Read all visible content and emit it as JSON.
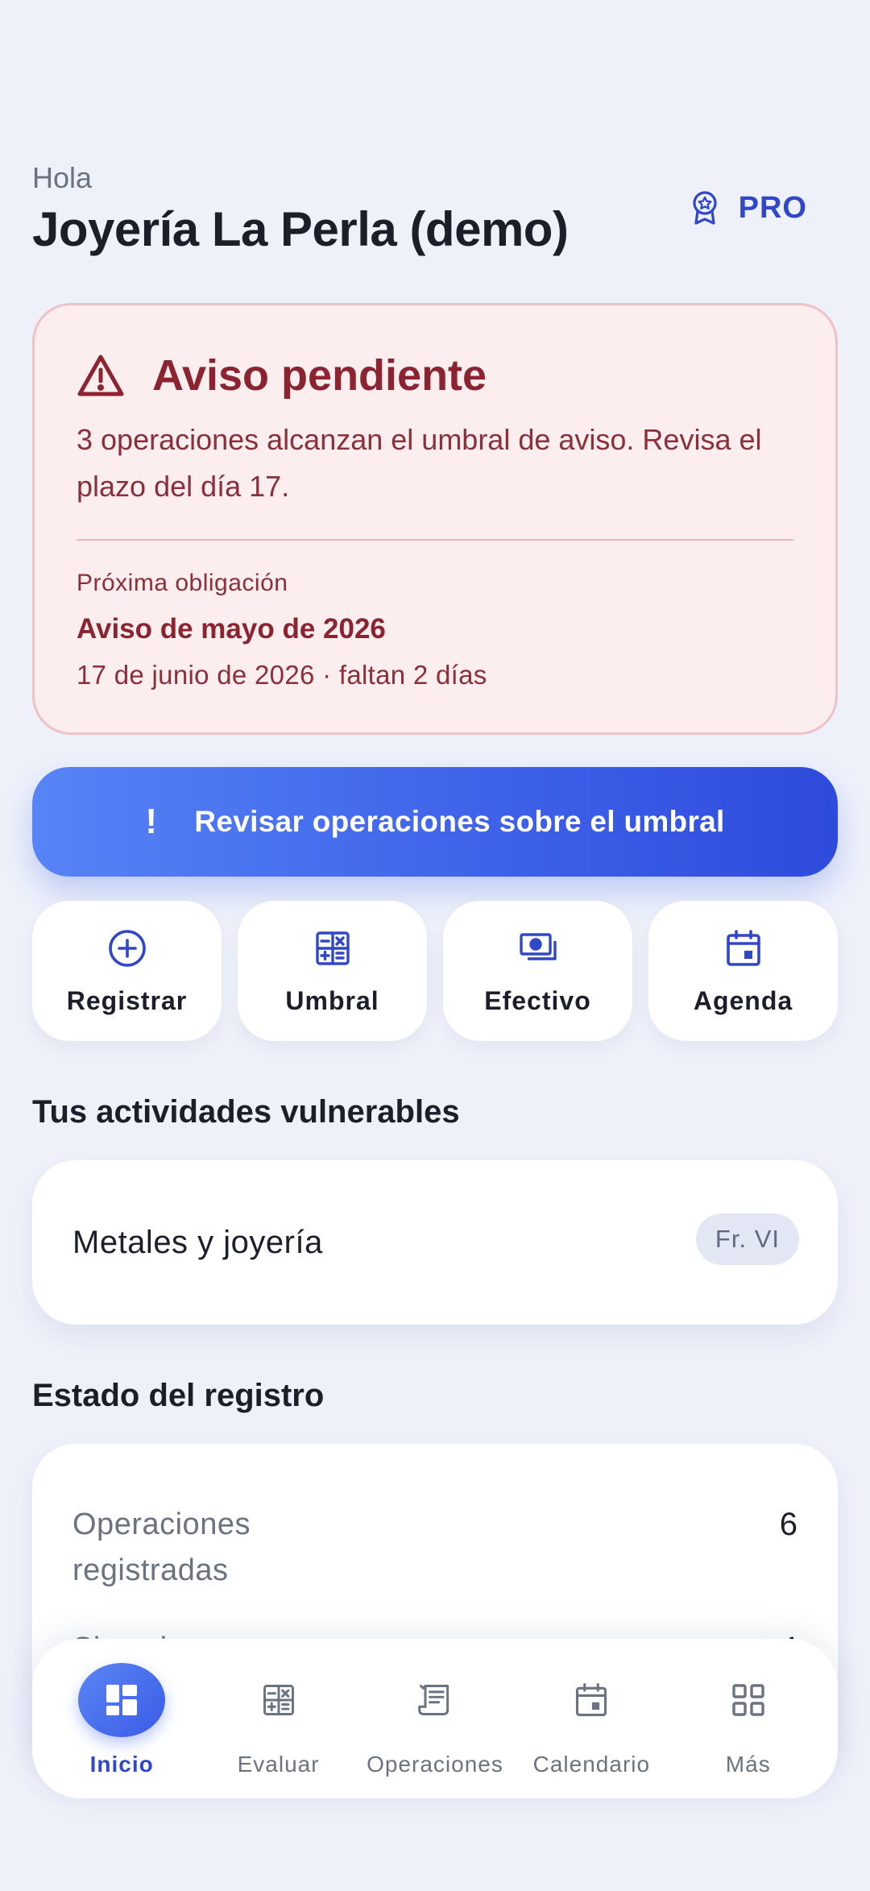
{
  "header": {
    "greeting": "Hola",
    "business_name": "Joyería La Perla (demo)",
    "plan_badge": "PRO",
    "plan_icon": "award-icon"
  },
  "alert": {
    "icon": "warning-triangle-icon",
    "title": "Aviso pendiente",
    "message": "3 operaciones alcanzan el umbral de aviso. Revisa el plazo del día 17.",
    "next_label": "Próxima obligación",
    "next_title": "Aviso de mayo de 2026",
    "next_date": "17 de junio de 2026 · faltan 2 días"
  },
  "cta": {
    "icon_glyph": "!",
    "label": "Revisar operaciones sobre el umbral"
  },
  "quick_actions": [
    {
      "label": "Registrar",
      "icon": "plus-circle-icon"
    },
    {
      "label": "Umbral",
      "icon": "calculator-icon"
    },
    {
      "label": "Efectivo",
      "icon": "cash-icon"
    },
    {
      "label": "Agenda",
      "icon": "calendar-icon"
    }
  ],
  "activities": {
    "title": "Tus actividades vulnerables",
    "items": [
      {
        "name": "Metales y joyería",
        "tag": "Fr. VI"
      }
    ]
  },
  "registry": {
    "title": "Estado del registro",
    "rows": [
      {
        "label": "Operaciones registradas",
        "value": "6"
      },
      {
        "label": "Sin aviso",
        "value": "4"
      }
    ]
  },
  "bottom_nav": {
    "items": [
      {
        "label": "Inicio",
        "icon": "dashboard-icon",
        "active": true
      },
      {
        "label": "Evaluar",
        "icon": "calculator-icon",
        "active": false
      },
      {
        "label": "Operaciones",
        "icon": "receipt-icon",
        "active": false
      },
      {
        "label": "Calendario",
        "icon": "calendar-icon",
        "active": false
      },
      {
        "label": "Más",
        "icon": "grid-icon",
        "active": false
      }
    ]
  },
  "colors": {
    "background": "#eef1fa",
    "accent": "#3047c9",
    "alert_bg": "#fcedee",
    "alert_text": "#8b2430",
    "cta_gradient_start": "#5784f6",
    "cta_gradient_end": "#2e4bdc"
  }
}
